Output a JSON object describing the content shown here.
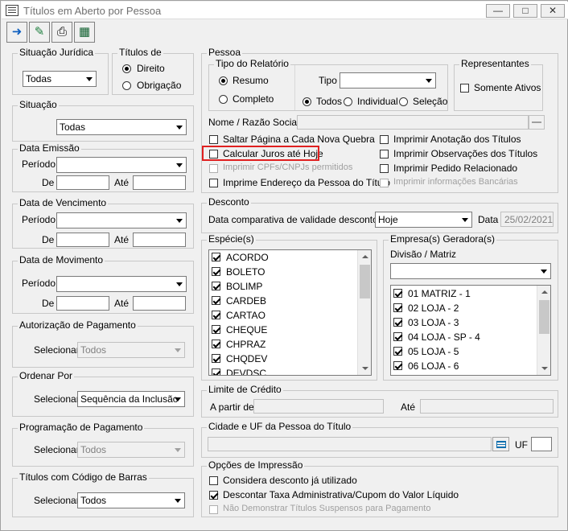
{
  "window": {
    "title": "Títulos em Aberto por Pessoa"
  },
  "toolbar": {
    "icons": [
      "exit-icon",
      "eraser-icon",
      "printer-icon",
      "report-icon"
    ]
  },
  "situacao_juridica": {
    "title": "Situação Jurídica",
    "value": "Todas"
  },
  "titulos_de": {
    "title": "Títulos de",
    "direito": "Direito",
    "obrigacao": "Obrigação",
    "selected": "Direito"
  },
  "situacao": {
    "title": "Situação",
    "value": "Todas"
  },
  "data_emissao": {
    "title": "Data Emissão",
    "periodo_label": "Período",
    "periodo_value": "",
    "de_label": "De",
    "ate_label": "Até",
    "de_value": "",
    "ate_value": ""
  },
  "data_vencimento": {
    "title": "Data de Vencimento",
    "periodo_label": "Período",
    "periodo_value": "",
    "de_label": "De",
    "ate_label": "Até",
    "de_value": "",
    "ate_value": ""
  },
  "data_movimento": {
    "title": "Data de Movimento",
    "periodo_label": "Período",
    "periodo_value": "",
    "de_label": "De",
    "ate_label": "Até",
    "de_value": "",
    "ate_value": ""
  },
  "autorizacao": {
    "title": "Autorização de Pagamento",
    "selecionar_label": "Selecionar",
    "value": "Todos"
  },
  "ordenar": {
    "title": "Ordenar Por",
    "selecionar_label": "Selecionar",
    "value": "Sequência da Inclusão"
  },
  "programacao": {
    "title": "Programação de Pagamento",
    "selecionar_label": "Selecionar",
    "value": "Todos"
  },
  "codigo_barras": {
    "title": "Títulos com Código de Barras",
    "selecionar_label": "Selecionar",
    "value": "Todos"
  },
  "pessoa": {
    "title": "Pessoa",
    "tipo_relatorio": {
      "title": "Tipo do Relatório",
      "resumo": "Resumo",
      "completo": "Completo",
      "selected": "Resumo",
      "tipo_label": "Tipo",
      "tipo_value": "",
      "todos": "Todos",
      "individual": "Individual",
      "selecao": "Seleção",
      "scope_selected": "Todos"
    },
    "representantes": {
      "title": "Representantes",
      "somente_ativos": "Somente Ativos"
    },
    "nome_label": "Nome / Razão Social",
    "nome_value": "",
    "checks_left": [
      {
        "label": "Saltar Página a Cada Nova Quebra",
        "checked": false,
        "disabled": false
      },
      {
        "label": "Calcular Juros até Hoje",
        "checked": false,
        "disabled": false
      },
      {
        "label": "Imprimir CPFs/CNPJs permitidos",
        "checked": false,
        "disabled": true
      },
      {
        "label": "Imprime Endereço da Pessoa do Título",
        "checked": false,
        "disabled": false
      }
    ],
    "checks_right": [
      {
        "label": "Imprimir Anotação dos Títulos",
        "checked": false,
        "disabled": false
      },
      {
        "label": "Imprimir Observações dos Títulos",
        "checked": false,
        "disabled": false
      },
      {
        "label": "Imprimir Pedido Relacionado",
        "checked": false,
        "disabled": false
      },
      {
        "label": "Imprimir informações Bancárias",
        "checked": false,
        "disabled": true
      }
    ]
  },
  "desconto": {
    "title": "Desconto",
    "label": "Data comparativa de validade desconto fin",
    "value": "Hoje",
    "data_label": "Data",
    "data_value": "25/02/2021"
  },
  "especies": {
    "title": "Espécie(s)",
    "items": [
      "ACORDO",
      "BOLETO",
      "BOLIMP",
      "CARDEB",
      "CARTAO",
      "CHEQUE",
      "CHPRAZ",
      "CHQDEV",
      "DEVDSC"
    ]
  },
  "empresas": {
    "title": "Empresa(s) Geradora(s)",
    "divisao_label": "Divisão / Matriz",
    "divisao_value": "",
    "items": [
      "01 MATRIZ - 1",
      "02 LOJA - 2",
      "03 LOJA - 3",
      "04 LOJA - SP - 4",
      "05 LOJA - 5",
      "06 LOJA - 6"
    ]
  },
  "limite": {
    "title": "Limite de Crédito",
    "a_partir_label": "A partir de",
    "ate_label": "Até",
    "a_partir_value": "",
    "ate_value": ""
  },
  "cidade": {
    "title": "Cidade e UF da Pessoa do Título",
    "value": "",
    "uf_label": "UF",
    "uf_value": ""
  },
  "opcoes": {
    "title": "Opções de Impressão",
    "checks": [
      {
        "label": "Considera desconto já utilizado",
        "checked": false,
        "disabled": false
      },
      {
        "label": "Descontar Taxa Administrativa/Cupom do Valor Líquido",
        "checked": true,
        "disabled": false
      },
      {
        "label": "Não Demonstrar Títulos Suspensos para Pagamento",
        "checked": false,
        "disabled": true
      }
    ]
  },
  "colors": {
    "highlight": "#e02020",
    "background": "#f0f0f0"
  }
}
